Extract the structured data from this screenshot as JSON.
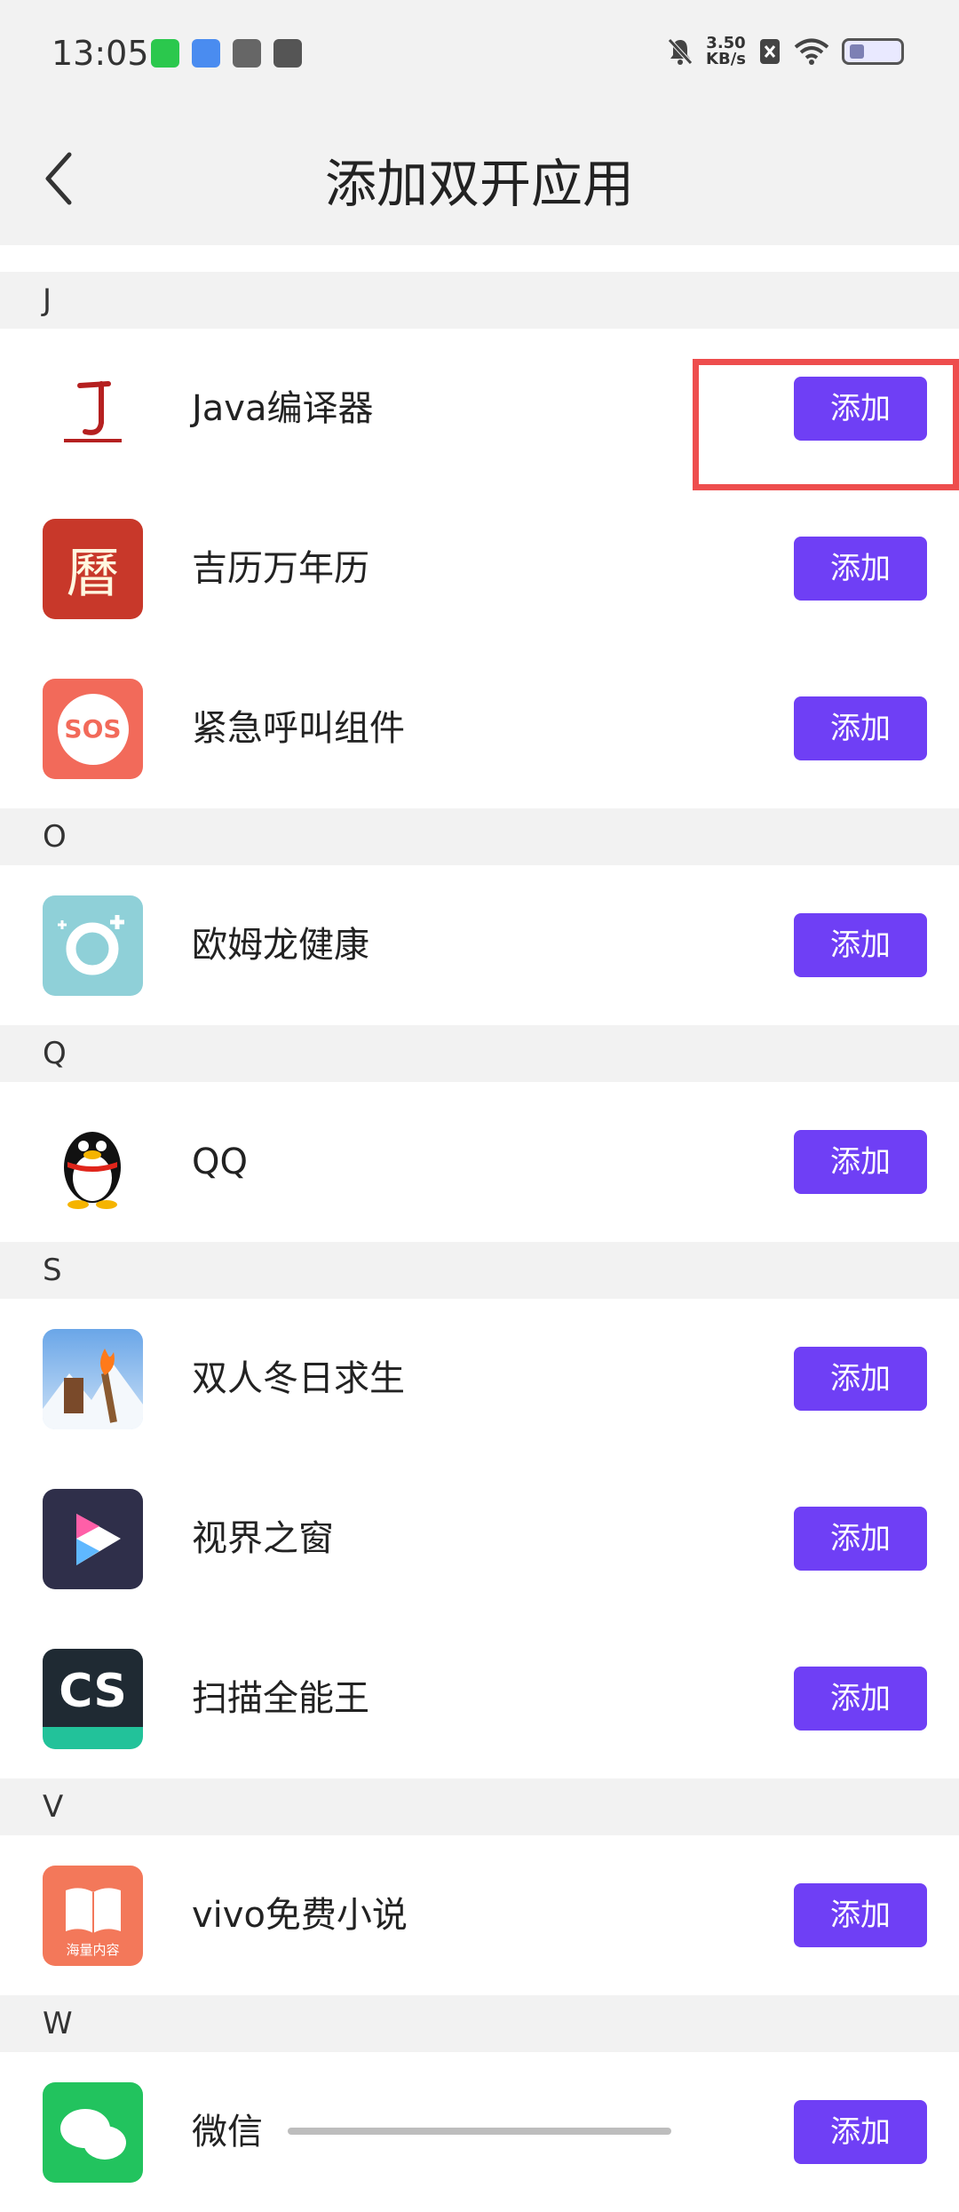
{
  "status": {
    "time": "13:05",
    "speed_value": "3.50",
    "speed_unit": "KB/s"
  },
  "nav": {
    "title": "添加双开应用",
    "back_icon": "chevron-left-icon"
  },
  "add_label": "添加",
  "sections": [
    {
      "letter": "J",
      "apps": [
        {
          "name": "Java编译器",
          "icon": "java-compiler-icon"
        },
        {
          "name": "吉历万年历",
          "icon": "calendar-icon",
          "icon_text": "曆"
        },
        {
          "name": "紧急呼叫组件",
          "icon": "sos-icon",
          "icon_text": "SOS"
        }
      ]
    },
    {
      "letter": "O",
      "apps": [
        {
          "name": "欧姆龙健康",
          "icon": "omron-health-icon"
        }
      ]
    },
    {
      "letter": "Q",
      "apps": [
        {
          "name": "QQ",
          "icon": "qq-penguin-icon"
        }
      ]
    },
    {
      "letter": "S",
      "apps": [
        {
          "name": "双人冬日求生",
          "icon": "game-torch-icon"
        },
        {
          "name": "视界之窗",
          "icon": "play-icon"
        },
        {
          "name": "扫描全能王",
          "icon": "camscanner-icon",
          "icon_text": "CS"
        }
      ]
    },
    {
      "letter": "V",
      "apps": [
        {
          "name": "vivo免费小说",
          "icon": "vivo-novel-icon",
          "icon_text": "海量内容"
        }
      ]
    },
    {
      "letter": "W",
      "apps": [
        {
          "name": "微信",
          "icon": "wechat-icon"
        }
      ]
    }
  ],
  "colors": {
    "accent": "#6f3ff5",
    "highlight": "#ee4d4d",
    "section_bg": "#f2f2f2"
  }
}
